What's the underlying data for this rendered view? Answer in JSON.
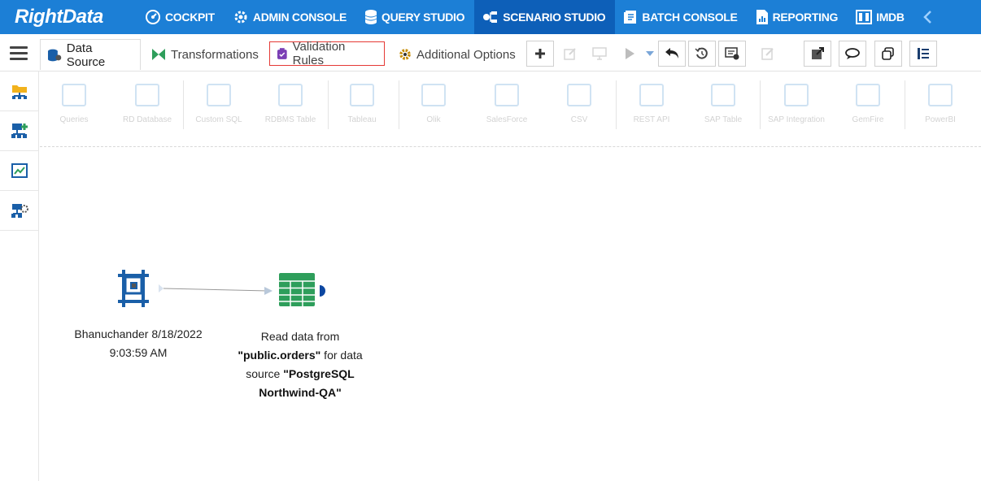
{
  "brand": {
    "logo_text": "RightData"
  },
  "topnav": {
    "items": [
      {
        "label": "COCKPIT",
        "icon": "cockpit-icon"
      },
      {
        "label": "ADMIN CONSOLE",
        "icon": "gear-icon"
      },
      {
        "label": "QUERY STUDIO",
        "icon": "database-icon"
      },
      {
        "label": "SCENARIO STUDIO",
        "icon": "scenario-icon",
        "active": true
      },
      {
        "label": "BATCH CONSOLE",
        "icon": "batch-icon"
      },
      {
        "label": "REPORTING",
        "icon": "report-icon"
      },
      {
        "label": "IMDB",
        "icon": "imdb-icon"
      }
    ]
  },
  "tabs": {
    "data_source": "Data Source",
    "transformations": "Transformations",
    "validation_rules": "Validation Rules",
    "additional_options": "Additional Options"
  },
  "palette": {
    "items": [
      "Queries",
      "RD Database",
      "Custom SQL",
      "RDBMS Table",
      "Tableau",
      "Olik",
      "SalesForce",
      "CSV",
      "REST API",
      "SAP Table",
      "SAP Integration",
      "GemFire",
      "PowerBI"
    ]
  },
  "canvas": {
    "node1": {
      "line1": "Bhanuchander 8/18/2022",
      "line2": "9:03:59 AM"
    },
    "node2": {
      "t1": "Read data from",
      "b1": "\"public.orders\"",
      "t2": " for data",
      "t3": "source ",
      "b2": "\"PostgreSQL",
      "b3": "Northwind-QA\""
    }
  },
  "colors": {
    "nav_bg": "#1c7fd6",
    "nav_active": "#0d5fb8",
    "highlight": "#e53935",
    "node_blue": "#1a5fa8",
    "table_green": "#2e9e5b"
  }
}
